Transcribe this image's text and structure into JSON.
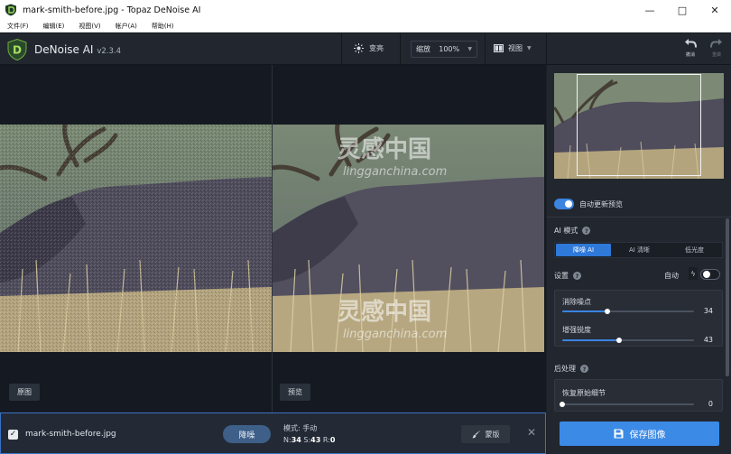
{
  "window": {
    "title": "mark-smith-before.jpg - Topaz DeNoise AI",
    "minimize_glyph": "—",
    "maximize_glyph": "□",
    "close_glyph": "✕"
  },
  "menu": [
    "文件(F)",
    "编辑(E)",
    "视图(V)",
    "帐户(A)",
    "帮助(H)"
  ],
  "app": {
    "name": "DeNoise AI",
    "version": "v2.3.4",
    "logo_letter": "D"
  },
  "toolbar": {
    "exposure_label": "变亮",
    "zoom_label": "缩放",
    "zoom_value": "100%",
    "view_label": "视图",
    "undo_label": "撤消",
    "redo_label": "重做"
  },
  "workspace": {
    "original_label": "原图",
    "preview_label": "预览",
    "watermark_text": "灵感中国",
    "watermark_url": "lingganchina.com"
  },
  "bottom": {
    "file_checked": true,
    "filename": "mark-smith-before.jpg",
    "denoise_button": "降噪",
    "mode_line": "模式: 手动",
    "n_label": "N:",
    "n_value": "34",
    "s_label": "S:",
    "s_value": "43",
    "r_label": "R:",
    "r_value": "0",
    "mask_button": "蒙版",
    "close_glyph": "✕"
  },
  "panel": {
    "auto_update_label": "自动更新预览",
    "auto_update_on": true,
    "ai_mode_label": "AI 模式",
    "modes": [
      {
        "label": "降噪 AI",
        "active": true
      },
      {
        "label": "AI 清晰",
        "active": false
      },
      {
        "label": "低光度",
        "active": false
      }
    ],
    "settings_label": "设置",
    "auto_label": "自动",
    "auto_on": false,
    "sliders": [
      {
        "label": "消除噪点",
        "value": "34",
        "fraction": 0.34
      },
      {
        "label": "增强锐度",
        "value": "43",
        "fraction": 0.43
      }
    ],
    "post_label": "后处理",
    "post_sliders": [
      {
        "label": "恢复原始细节",
        "value": "0",
        "fraction": 0.0
      }
    ],
    "save_button": "保存图像"
  },
  "colors": {
    "accent": "#3b8ae6",
    "toggle_on": "#3b84e0",
    "selection_border": "#3b72c6"
  }
}
